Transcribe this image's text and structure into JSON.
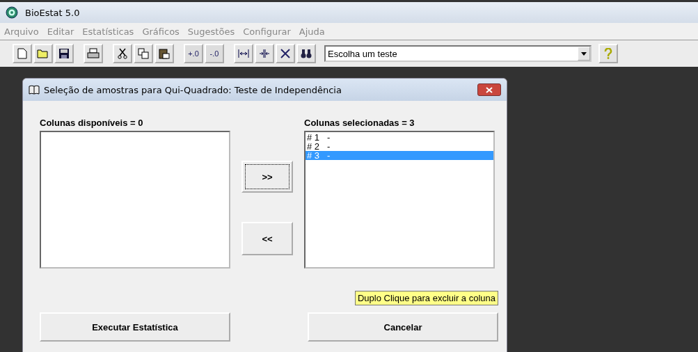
{
  "window": {
    "title": "BioEstat 5.0"
  },
  "menu": [
    "Arquivo",
    "Editar",
    "Estatísticas",
    "Gráficos",
    "Sugestões",
    "Configurar",
    "Ajuda"
  ],
  "toolbar": {
    "decimal_buttons": [
      "+.0",
      "-.0"
    ],
    "test_select": {
      "value": "Escolha um teste"
    }
  },
  "dialog": {
    "title": "Seleção de amostras para Qui-Quadrado: Teste de Independência",
    "available_label": "Colunas disponíveis =  0",
    "selected_label": "Colunas selecionadas =  3",
    "selected_items": [
      {
        "label": "# 1   -",
        "selected": false
      },
      {
        "label": "# 2   -",
        "selected": false
      },
      {
        "label": "# 3   -",
        "selected": true
      }
    ],
    "add_button": ">>",
    "remove_button": "<<",
    "tooltip": "Duplo Clique para excluir a coluna",
    "run_button": "Executar Estatística",
    "cancel_button": "Cancelar"
  }
}
